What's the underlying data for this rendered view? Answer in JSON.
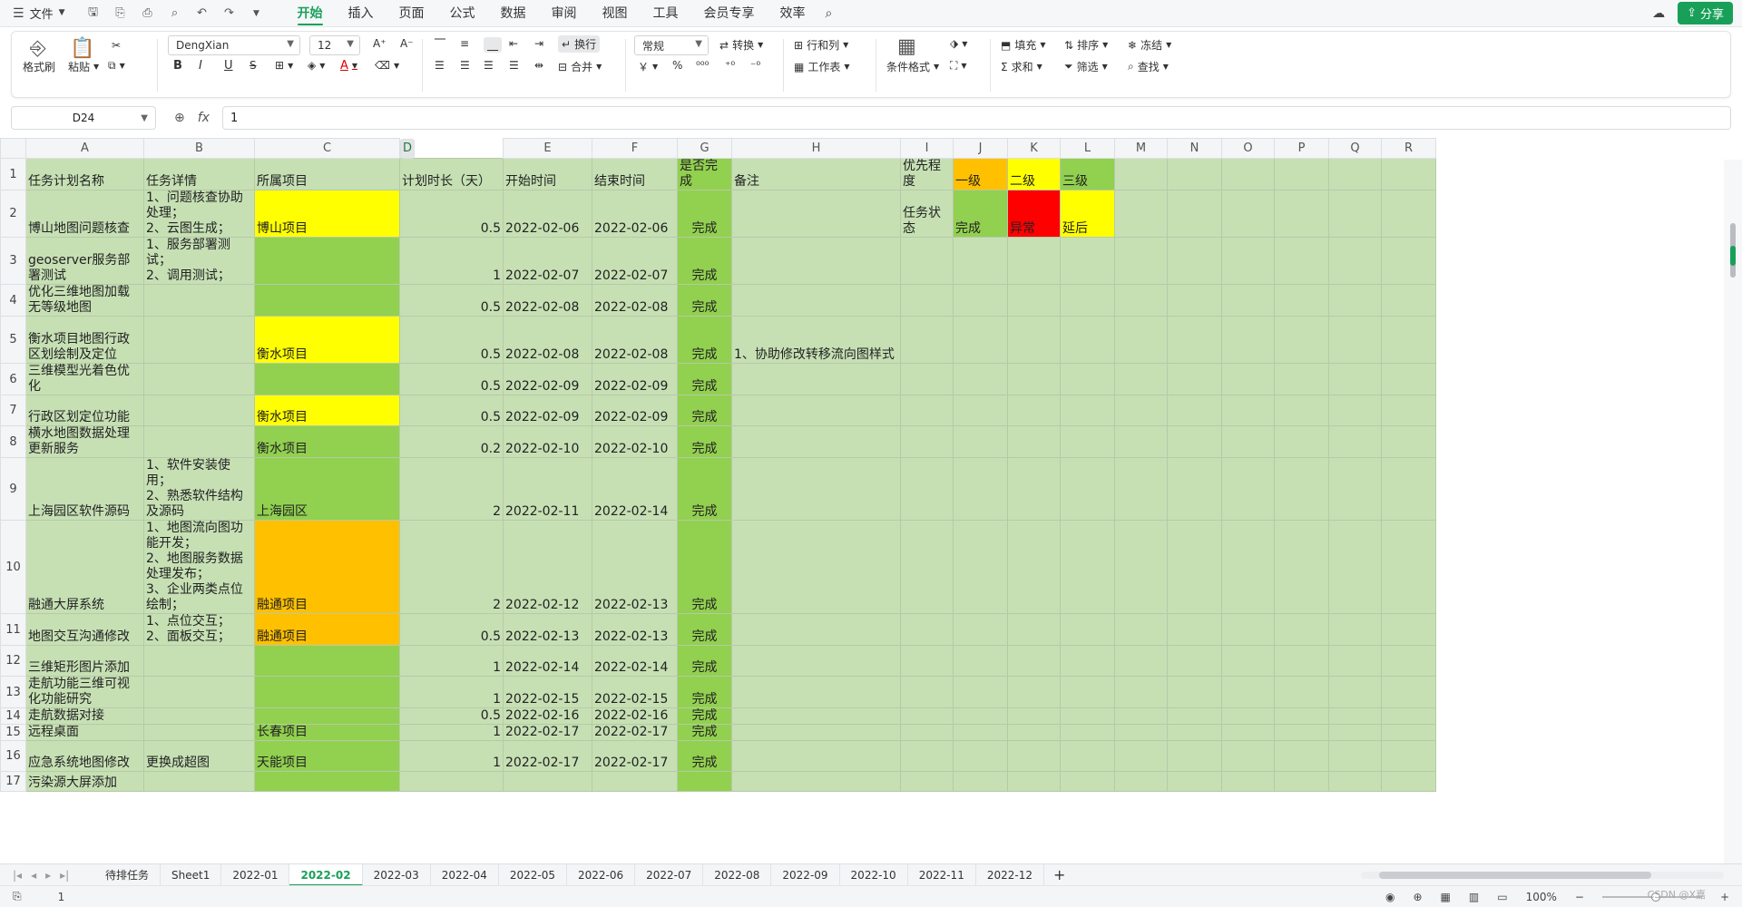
{
  "menubar": {
    "file_label": "文件",
    "tabs": [
      "开始",
      "插入",
      "页面",
      "公式",
      "数据",
      "审阅",
      "视图",
      "工具",
      "会员专享",
      "效率"
    ],
    "active_tab": "开始",
    "share_label": "分享"
  },
  "ribbon": {
    "format_painter": "格式刷",
    "paste": "粘贴",
    "font_name": "DengXian",
    "font_size": "12",
    "wrap": "换行",
    "merge": "合并",
    "number_format": "常规",
    "convert": "转换",
    "row_col": "行和列",
    "worksheet": "工作表",
    "cond_format": "条件格式",
    "fill": "填充",
    "sort": "排序",
    "freeze": "冻结",
    "sum": "求和",
    "filter": "筛选",
    "find": "查找",
    "bold": "B",
    "italic": "I",
    "underline": "U",
    "font_color": "A",
    "currency": "￥",
    "percent": "%"
  },
  "formula_bar": {
    "cell_ref": "D24",
    "fx": "fx",
    "value": "1"
  },
  "colors": {
    "accent": "#18a058",
    "cell_bg": "#c6e0b4",
    "yellow": "#ffff00",
    "orange": "#ffc000",
    "green": "#92d050",
    "red": "#ff0000"
  },
  "columns": [
    "A",
    "B",
    "C",
    "D",
    "E",
    "F",
    "G",
    "H",
    "I",
    "J",
    "K",
    "L",
    "M",
    "N",
    "O",
    "P",
    "Q",
    "R"
  ],
  "rows": [
    {
      "n": "1",
      "A": "任务计划名称",
      "B": "任务详情",
      "C": "所属项目",
      "D": "计划时长（天）",
      "E": "开始时间",
      "F": "结束时间",
      "G": "是否完成",
      "H": "备注",
      "I": "优先程度",
      "J": "一级",
      "K": "二级",
      "L": "三级"
    },
    {
      "n": "2",
      "A": "博山地图问题核查",
      "B": "1、问题核查协助处理；\n2、云图生成；",
      "C": "博山项目",
      "D": "0.5",
      "E": "2022-02-06",
      "F": "2022-02-06",
      "G": "完成",
      "H": "",
      "I": "任务状态",
      "J": "完成",
      "K": "异常",
      "L": "延后"
    },
    {
      "n": "3",
      "A": "geoserver服务部署测试",
      "B": "1、服务部署测试；\n2、调用测试；",
      "C": "",
      "D": "1",
      "E": "2022-02-07",
      "F": "2022-02-07",
      "G": "完成",
      "H": ""
    },
    {
      "n": "4",
      "A": "优化三维地图加载无等级地图",
      "B": "",
      "C": "",
      "D": "0.5",
      "E": "2022-02-08",
      "F": "2022-02-08",
      "G": "完成",
      "H": ""
    },
    {
      "n": "5",
      "A": "衡水项目地图行政区划绘制及定位",
      "B": "",
      "C": "衡水项目",
      "D": "0.5",
      "E": "2022-02-08",
      "F": "2022-02-08",
      "G": "完成",
      "H": "1、协助修改转移流向图样式"
    },
    {
      "n": "6",
      "A": "三维模型光着色优化",
      "B": "",
      "C": "",
      "D": "0.5",
      "E": "2022-02-09",
      "F": "2022-02-09",
      "G": "完成",
      "H": ""
    },
    {
      "n": "7",
      "A": "行政区划定位功能",
      "B": "",
      "C": "衡水项目",
      "D": "0.5",
      "E": "2022-02-09",
      "F": "2022-02-09",
      "G": "完成",
      "H": ""
    },
    {
      "n": "8",
      "A": "横水地图数据处理更新服务",
      "B": "",
      "C": "衡水项目",
      "D": "0.2",
      "E": "2022-02-10",
      "F": "2022-02-10",
      "G": "完成",
      "H": ""
    },
    {
      "n": "9",
      "A": "上海园区软件源码",
      "B": "1、软件安装使用；\n2、熟悉软件结构及源码",
      "C": "上海园区",
      "D": "2",
      "E": "2022-02-11",
      "F": "2022-02-14",
      "G": "完成",
      "H": ""
    },
    {
      "n": "10",
      "A": "融通大屏系统",
      "B": "1、地图流向图功能开发；\n2、地图服务数据处理发布；\n3、企业两类点位绘制；",
      "C": "融通项目",
      "D": "2",
      "E": "2022-02-12",
      "F": "2022-02-13",
      "G": "完成",
      "H": ""
    },
    {
      "n": "11",
      "A": "地图交互沟通修改",
      "B": "1、点位交互；\n2、面板交互；",
      "C": "融通项目",
      "D": "0.5",
      "E": "2022-02-13",
      "F": "2022-02-13",
      "G": "完成",
      "H": ""
    },
    {
      "n": "12",
      "A": "三维矩形图片添加",
      "B": "",
      "C": "",
      "D": "1",
      "E": "2022-02-14",
      "F": "2022-02-14",
      "G": "完成",
      "H": ""
    },
    {
      "n": "13",
      "A": "走航功能三维可视化功能研究",
      "B": "",
      "C": "",
      "D": "1",
      "E": "2022-02-15",
      "F": "2022-02-15",
      "G": "完成",
      "H": ""
    },
    {
      "n": "14",
      "A": "走航数据对接",
      "B": "",
      "C": "",
      "D": "0.5",
      "E": "2022-02-16",
      "F": "2022-02-16",
      "G": "完成",
      "H": ""
    },
    {
      "n": "15",
      "A": "远程桌面",
      "B": "",
      "C": "长春项目",
      "D": "1",
      "E": "2022-02-17",
      "F": "2022-02-17",
      "G": "完成",
      "H": ""
    },
    {
      "n": "16",
      "A": "应急系统地图修改",
      "B": "更换成超图",
      "C": "天能项目",
      "D": "1",
      "E": "2022-02-17",
      "F": "2022-02-17",
      "G": "完成",
      "H": ""
    },
    {
      "n": "17",
      "A": "污染源大屏添加",
      "B": "",
      "C": "",
      "D": "",
      "E": "",
      "F": "",
      "G": "",
      "H": ""
    }
  ],
  "sheet_tabs": [
    "待排任务",
    "Sheet1",
    "2022-01",
    "2022-02",
    "2022-03",
    "2022-04",
    "2022-05",
    "2022-06",
    "2022-07",
    "2022-08",
    "2022-09",
    "2022-10",
    "2022-11",
    "2022-12"
  ],
  "active_sheet": "2022-02",
  "status": {
    "page": "1",
    "zoom": "100%",
    "watermark": "CSDN @X嘉"
  }
}
